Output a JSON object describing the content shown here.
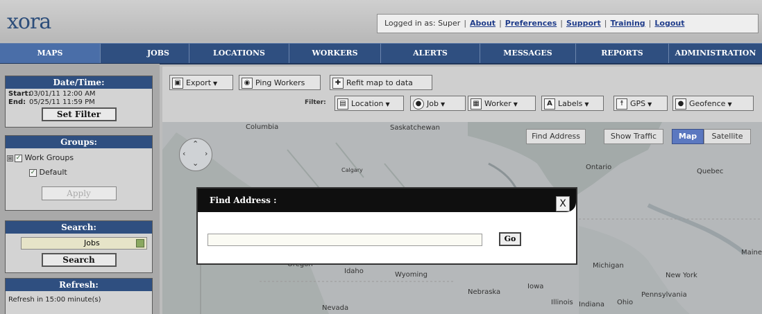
{
  "app": {
    "logo": "xora"
  },
  "header": {
    "logged_in_label": "Logged in as: Super",
    "links": [
      "About",
      "Preferences",
      "Support",
      "Training",
      "Logout"
    ]
  },
  "nav": {
    "tabs": [
      "MAPS",
      "JOBS",
      "LOCATIONS",
      "WORKERS",
      "ALERTS",
      "MESSAGES",
      "REPORTS",
      "ADMINISTRATION"
    ],
    "active": "MAPS"
  },
  "sidebar": {
    "datetime": {
      "title": "Date/Time:",
      "start_label": "Start:",
      "start_value": "03/01/11 12:00 AM",
      "end_label": "End:",
      "end_value": "05/25/11 11:59 PM",
      "button": "Set Filter"
    },
    "groups": {
      "title": "Groups:",
      "expander": "⊞",
      "parent": "Work Groups",
      "child": "Default",
      "button": "Apply"
    },
    "search": {
      "title": "Search:",
      "value": "Jobs",
      "button": "Search"
    },
    "refresh": {
      "title": "Refresh:",
      "text": "Refresh in 15:00 minute(s)"
    }
  },
  "toolbar": {
    "export": "Export",
    "ping": "Ping Workers",
    "refit": "Refit map to data",
    "filter_label": "Filter:",
    "filters": [
      "Location",
      "Job",
      "Worker",
      "Labels",
      "GPS",
      "Geofence"
    ]
  },
  "map": {
    "controls": {
      "find": "Find Address",
      "traffic": "Show Traffic",
      "map": "Map",
      "satellite": "Satellite"
    },
    "labels": {
      "columbia": "Columbia",
      "saskatchewan": "Saskatchewan",
      "ontario": "Ontario",
      "quebec": "Quebec",
      "calgary": "Calgary",
      "oregon": "Oregon",
      "idaho": "Idaho",
      "wyoming": "Wyoming",
      "nebraska": "Nebraska",
      "iowa": "Iowa",
      "michigan": "Michigan",
      "new_york": "New York",
      "illinois": "Illinois",
      "indiana": "Indiana",
      "ohio": "Ohio",
      "pennsylvania": "Pennsylvania",
      "nevada": "Nevada",
      "maine": "Maine"
    }
  },
  "dialog": {
    "title": "Find Address :",
    "close": "X",
    "input_value": "",
    "go": "Go"
  },
  "icons": {
    "export": "export-icon",
    "ping": "ping-icon",
    "refit": "refit-icon",
    "location": "location-icon",
    "job": "job-icon",
    "worker": "worker-icon",
    "labels": "labels-icon",
    "gps": "gps-icon",
    "geofence": "geofence-icon"
  },
  "colors": {
    "nav": "#2f4f80",
    "active_tab": "#4a6ea8",
    "map_toggle": "#5b78c0"
  }
}
